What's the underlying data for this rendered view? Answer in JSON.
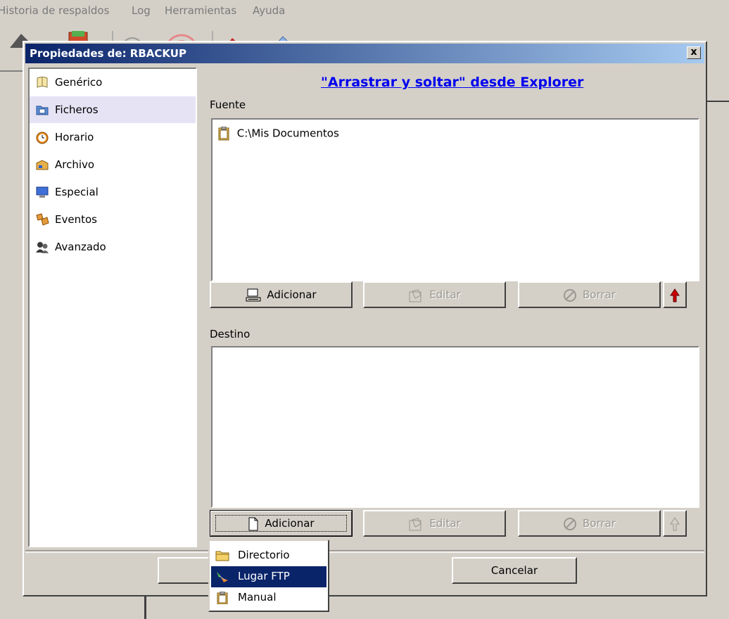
{
  "background_app": {
    "menu": [
      "Historia de respaldos",
      "Log",
      "Herramientas",
      "Ayuda"
    ]
  },
  "dialog": {
    "title": "Propiedades de: RBACKUP",
    "close_label": "x"
  },
  "nav": {
    "items": [
      {
        "label": "Genérico",
        "icon": "generic-icon",
        "color": "#f5e6a8"
      },
      {
        "label": "Ficheros",
        "icon": "files-icon",
        "color": "#5b8fd6"
      },
      {
        "label": "Horario",
        "icon": "alarm-clock-icon",
        "color": "#e98a1c"
      },
      {
        "label": "Archivo",
        "icon": "archive-box-icon",
        "color": "#e8b04a"
      },
      {
        "label": "Especial",
        "icon": "monitor-icon",
        "color": "#3f6fd8"
      },
      {
        "label": "Eventos",
        "icon": "events-icon",
        "color": "#e59b3a"
      },
      {
        "label": "Avanzado",
        "icon": "advanced-users-icon",
        "color": "#3a3a3a"
      }
    ],
    "selected": "Ficheros"
  },
  "main": {
    "link": "\"Arrastrar y soltar\" desde Explorer",
    "source": {
      "label": "Fuente",
      "items": [
        "C:\\Mis Documentos"
      ],
      "buttons": {
        "add": "Adicionar",
        "edit": "Editar",
        "delete": "Borrar"
      }
    },
    "destination": {
      "label": "Destino",
      "items": [],
      "buttons": {
        "add": "Adicionar",
        "edit": "Editar",
        "delete": "Borrar"
      }
    }
  },
  "footer": {
    "cancel": "Cancelar"
  },
  "popup_menu": {
    "items": [
      "Directorio",
      "Lugar FTP",
      "Manual"
    ],
    "highlighted": "Lugar FTP"
  },
  "colors": {
    "titlebar_start": "#0a246a",
    "titlebar_end": "#a6caf0",
    "link": "#0000ee",
    "highlight": "#0a246a",
    "arrow_red": "#cc0000"
  }
}
